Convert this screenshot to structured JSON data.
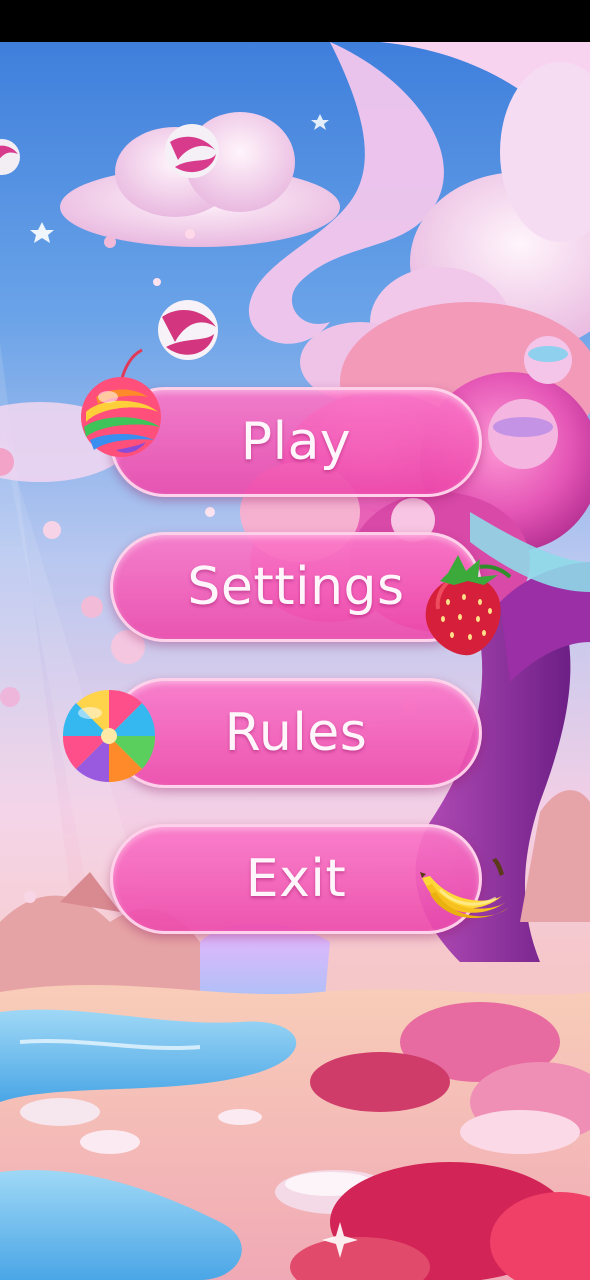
{
  "menu": {
    "play_label": "Play",
    "settings_label": "Settings",
    "rules_label": "Rules",
    "exit_label": "Exit"
  },
  "icons": {
    "play": "rainbow-candy-ball-icon",
    "settings": "strawberry-icon",
    "rules": "swirl-lollipop-icon",
    "exit": "banana-icon"
  },
  "colors": {
    "button_fill": "#ee4fae",
    "button_border": "#ffd6ec",
    "button_text": "#fff6fb",
    "sky": "#4a86e0",
    "tree_trunk": "#8b2a9c"
  }
}
